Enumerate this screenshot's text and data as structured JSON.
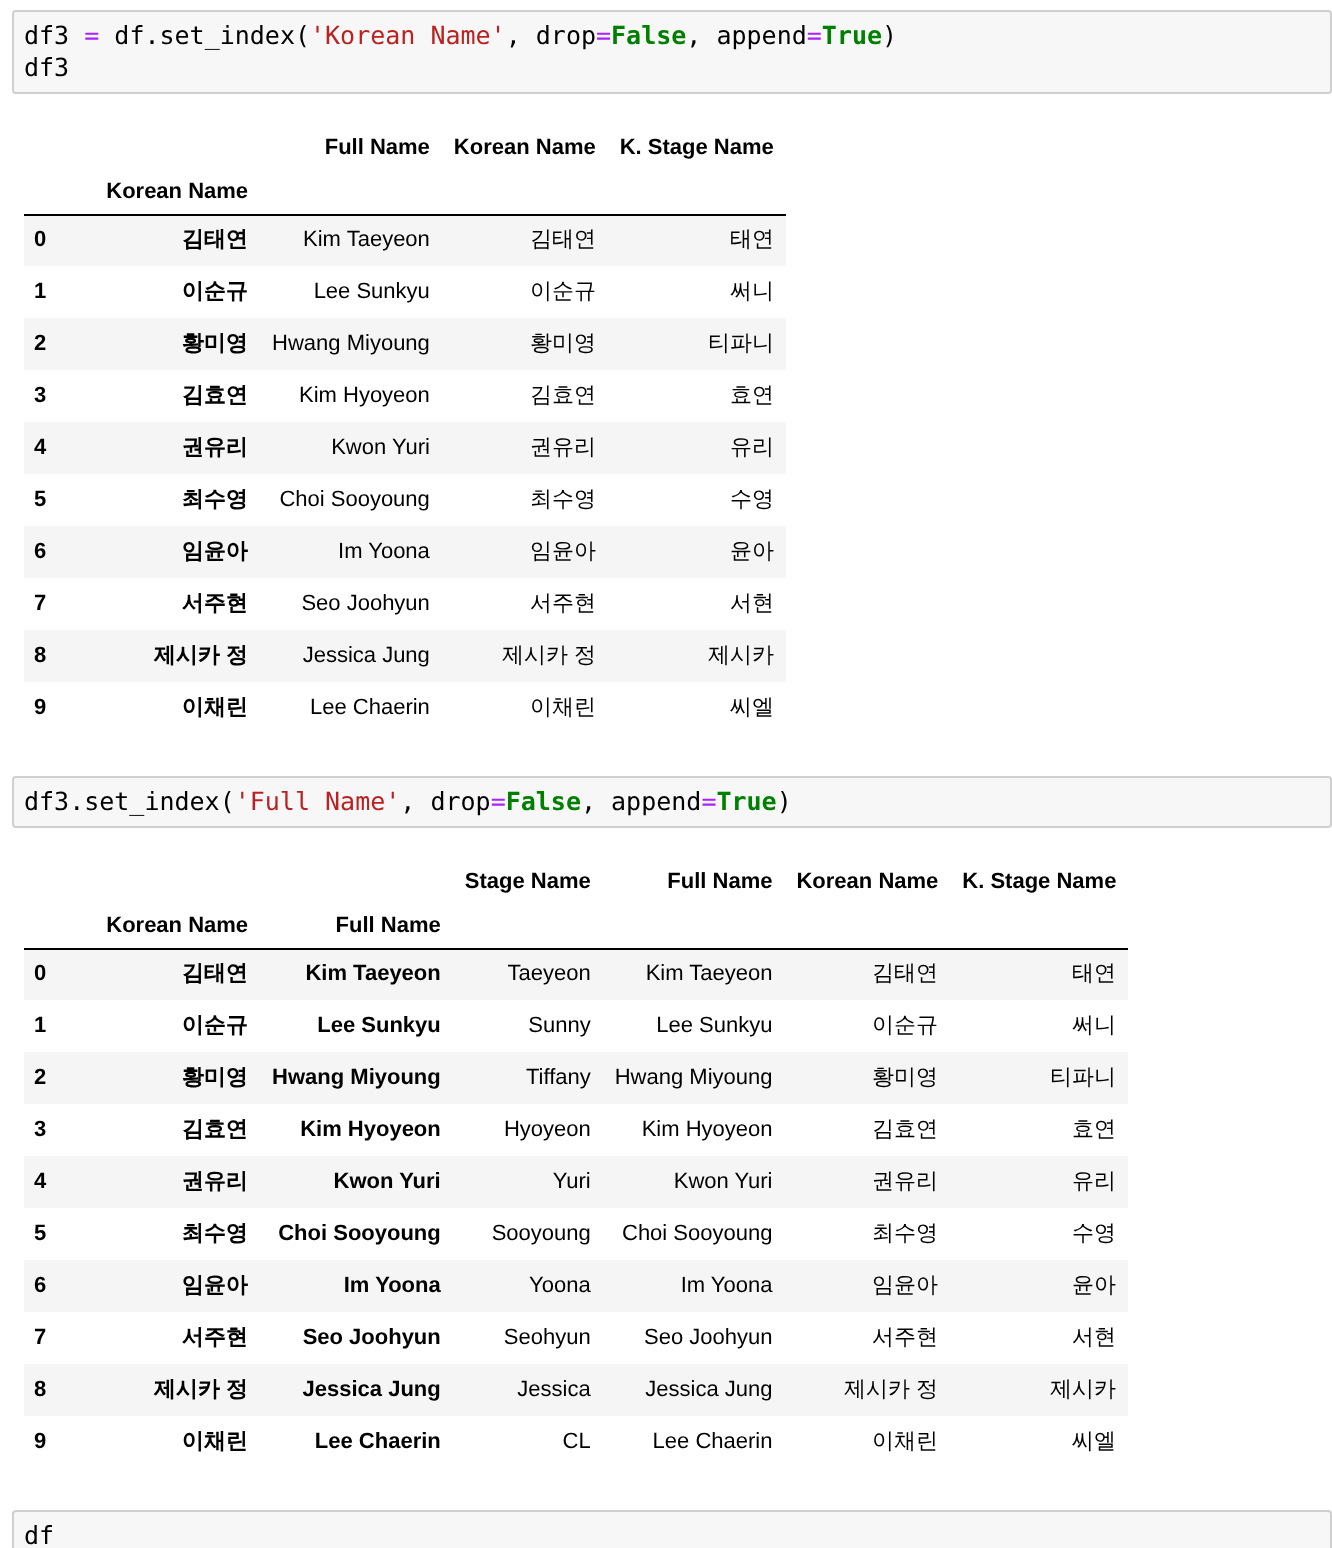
{
  "cells": [
    {
      "kind": "code",
      "lines": [
        [
          {
            "text": "df3 ",
            "kind": "plain"
          },
          {
            "text": "=",
            "kind": "op"
          },
          {
            "text": " df.set_index(",
            "kind": "plain"
          },
          {
            "text": "'Korean Name'",
            "kind": "string"
          },
          {
            "text": ", drop",
            "kind": "plain"
          },
          {
            "text": "=",
            "kind": "op"
          },
          {
            "text": "False",
            "kind": "keyword"
          },
          {
            "text": ", append",
            "kind": "plain"
          },
          {
            "text": "=",
            "kind": "op"
          },
          {
            "text": "True",
            "kind": "keyword"
          },
          {
            "text": ")",
            "kind": "plain"
          }
        ],
        [
          {
            "text": "df3",
            "kind": "plain"
          }
        ]
      ]
    },
    {
      "kind": "table",
      "columns": [
        "Full Name",
        "Korean Name",
        "K. Stage Name"
      ],
      "index_names": [
        "Korean Name"
      ],
      "rows": [
        {
          "index": [
            "0",
            "김태연"
          ],
          "values": [
            "Kim Taeyeon",
            "김태연",
            "태연"
          ]
        },
        {
          "index": [
            "1",
            "이순규"
          ],
          "values": [
            "Lee Sunkyu",
            "이순규",
            "써니"
          ]
        },
        {
          "index": [
            "2",
            "황미영"
          ],
          "values": [
            "Hwang Miyoung",
            "황미영",
            "티파니"
          ]
        },
        {
          "index": [
            "3",
            "김효연"
          ],
          "values": [
            "Kim Hyoyeon",
            "김효연",
            "효연"
          ]
        },
        {
          "index": [
            "4",
            "권유리"
          ],
          "values": [
            "Kwon Yuri",
            "권유리",
            "유리"
          ]
        },
        {
          "index": [
            "5",
            "최수영"
          ],
          "values": [
            "Choi Sooyoung",
            "최수영",
            "수영"
          ]
        },
        {
          "index": [
            "6",
            "임윤아"
          ],
          "values": [
            "Im Yoona",
            "임윤아",
            "윤아"
          ]
        },
        {
          "index": [
            "7",
            "서주현"
          ],
          "values": [
            "Seo Joohyun",
            "서주현",
            "서현"
          ]
        },
        {
          "index": [
            "8",
            "제시카 정"
          ],
          "values": [
            "Jessica Jung",
            "제시카 정",
            "제시카"
          ]
        },
        {
          "index": [
            "9",
            "이채린"
          ],
          "values": [
            "Lee Chaerin",
            "이채린",
            "씨엘"
          ]
        }
      ]
    },
    {
      "kind": "code",
      "lines": [
        [
          {
            "text": "df3.set_index(",
            "kind": "plain"
          },
          {
            "text": "'Full Name'",
            "kind": "string"
          },
          {
            "text": ", drop",
            "kind": "plain"
          },
          {
            "text": "=",
            "kind": "op"
          },
          {
            "text": "False",
            "kind": "keyword"
          },
          {
            "text": ", append",
            "kind": "plain"
          },
          {
            "text": "=",
            "kind": "op"
          },
          {
            "text": "True",
            "kind": "keyword"
          },
          {
            "text": ")",
            "kind": "plain"
          }
        ]
      ]
    },
    {
      "kind": "table",
      "columns": [
        "Stage Name",
        "Full Name",
        "Korean Name",
        "K. Stage Name"
      ],
      "index_names": [
        "Korean Name",
        "Full Name"
      ],
      "rows": [
        {
          "index": [
            "0",
            "김태연",
            "Kim Taeyeon"
          ],
          "values": [
            "Taeyeon",
            "Kim Taeyeon",
            "김태연",
            "태연"
          ]
        },
        {
          "index": [
            "1",
            "이순규",
            "Lee Sunkyu"
          ],
          "values": [
            "Sunny",
            "Lee Sunkyu",
            "이순규",
            "써니"
          ]
        },
        {
          "index": [
            "2",
            "황미영",
            "Hwang Miyoung"
          ],
          "values": [
            "Tiffany",
            "Hwang Miyoung",
            "황미영",
            "티파니"
          ]
        },
        {
          "index": [
            "3",
            "김효연",
            "Kim Hyoyeon"
          ],
          "values": [
            "Hyoyeon",
            "Kim Hyoyeon",
            "김효연",
            "효연"
          ]
        },
        {
          "index": [
            "4",
            "권유리",
            "Kwon Yuri"
          ],
          "values": [
            "Yuri",
            "Kwon Yuri",
            "권유리",
            "유리"
          ]
        },
        {
          "index": [
            "5",
            "최수영",
            "Choi Sooyoung"
          ],
          "values": [
            "Sooyoung",
            "Choi Sooyoung",
            "최수영",
            "수영"
          ]
        },
        {
          "index": [
            "6",
            "임윤아",
            "Im Yoona"
          ],
          "values": [
            "Yoona",
            "Im Yoona",
            "임윤아",
            "윤아"
          ]
        },
        {
          "index": [
            "7",
            "서주현",
            "Seo Joohyun"
          ],
          "values": [
            "Seohyun",
            "Seo Joohyun",
            "서주현",
            "서현"
          ]
        },
        {
          "index": [
            "8",
            "제시카 정",
            "Jessica Jung"
          ],
          "values": [
            "Jessica",
            "Jessica Jung",
            "제시카 정",
            "제시카"
          ]
        },
        {
          "index": [
            "9",
            "이채린",
            "Lee Chaerin"
          ],
          "values": [
            "CL",
            "Lee Chaerin",
            "이채린",
            "씨엘"
          ]
        }
      ]
    },
    {
      "kind": "code",
      "lines": [
        [
          {
            "text": "df",
            "kind": "plain"
          }
        ]
      ]
    }
  ]
}
